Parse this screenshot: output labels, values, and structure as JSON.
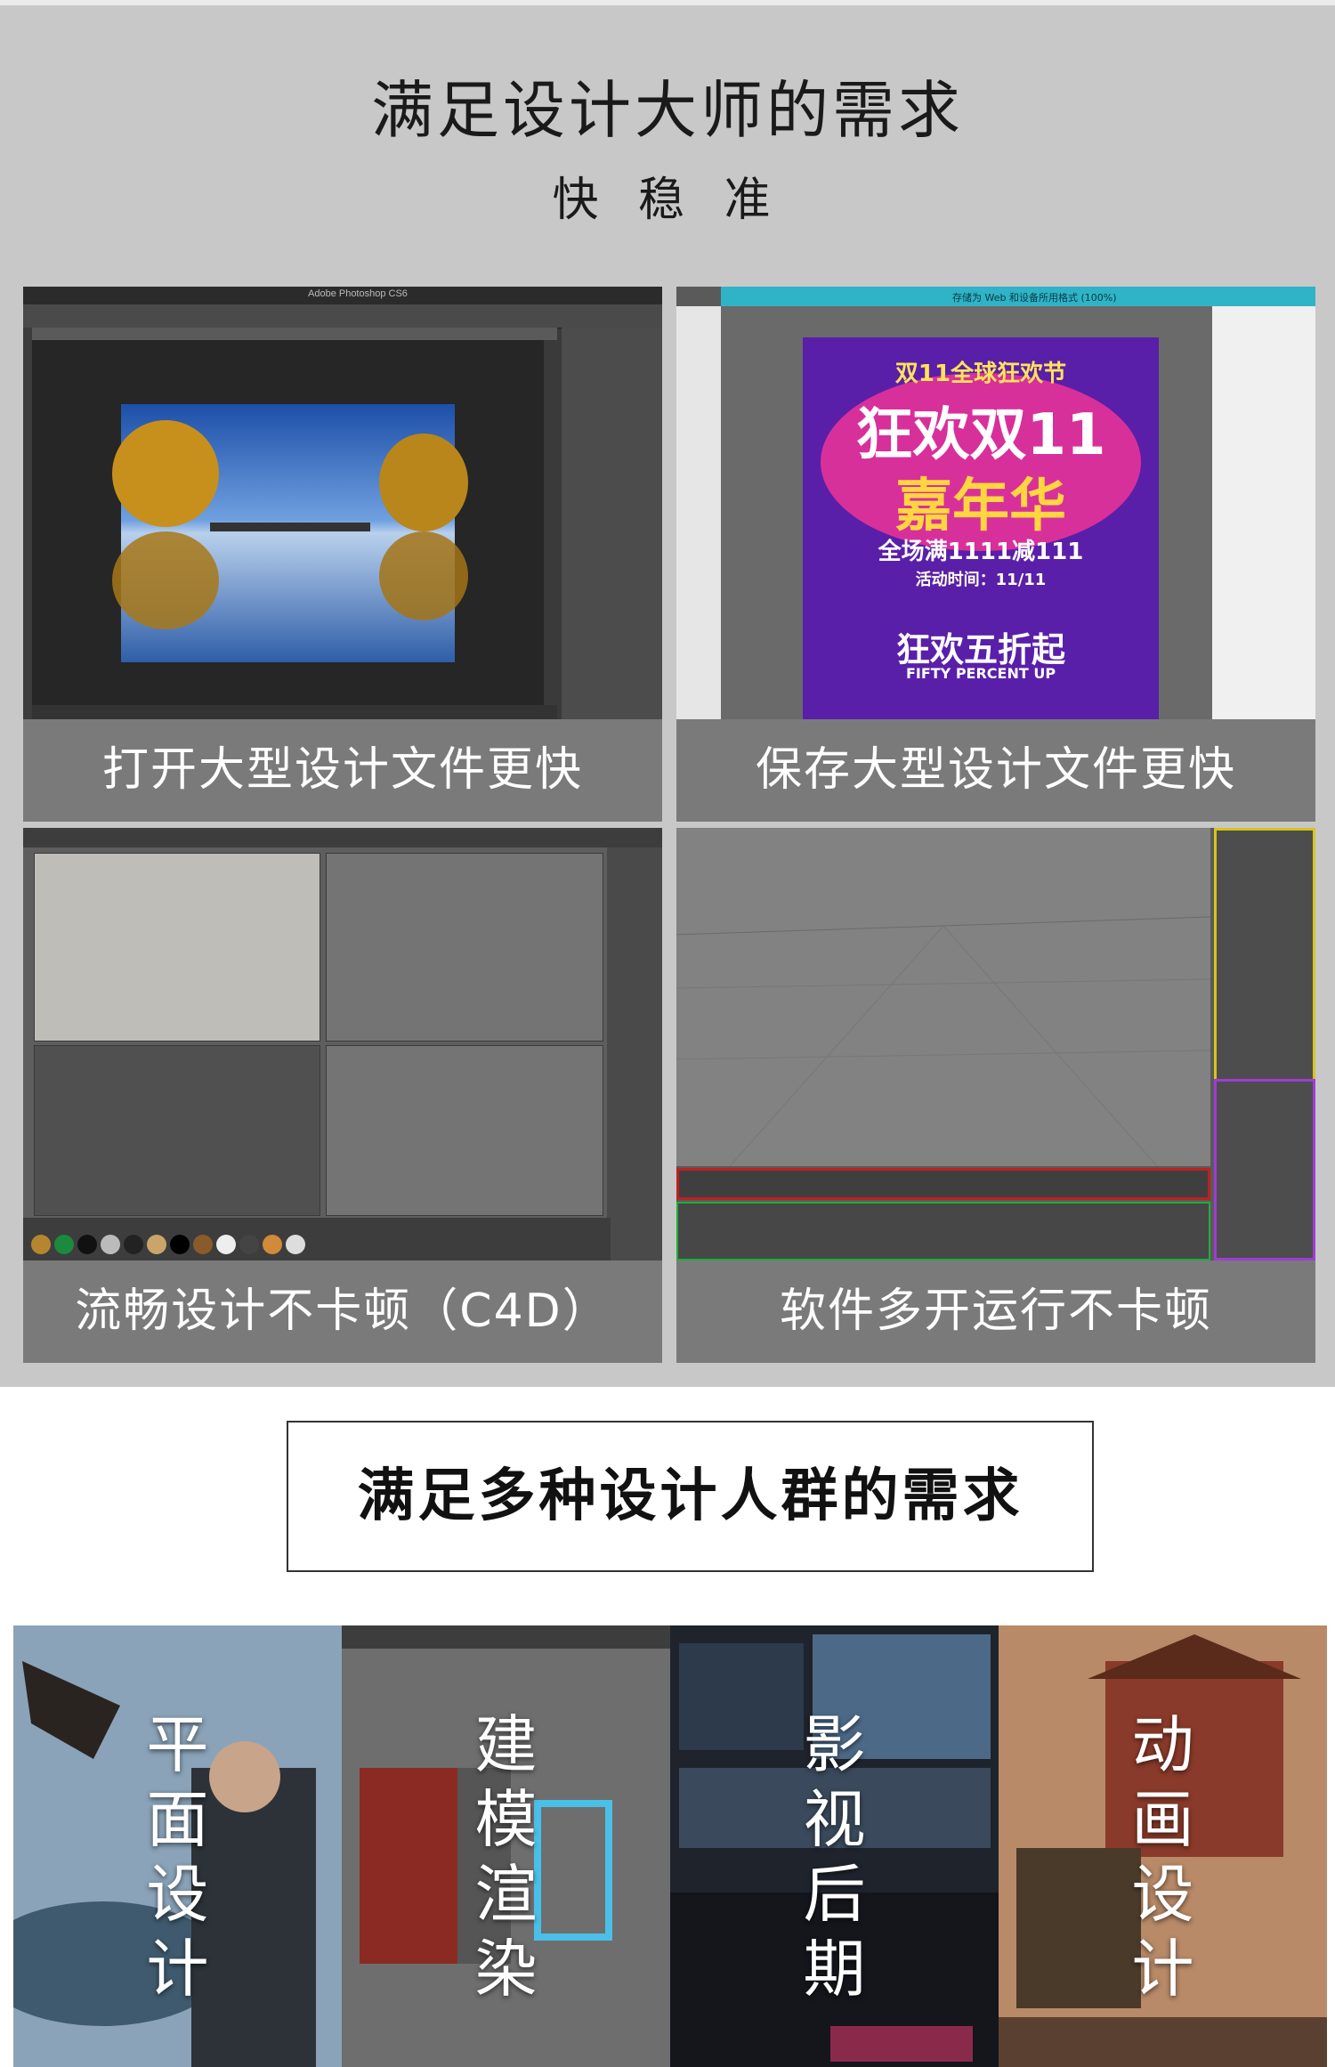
{
  "header": {
    "title": "满足设计大师的需求",
    "subtitle": "快 稳 准"
  },
  "cards": [
    {
      "caption": "打开大型设计文件更快",
      "window_title": "Adobe Photoshop CS6"
    },
    {
      "caption": "保存大型设计文件更快",
      "window_title": "存储为 Web 和设备所用格式 (100%)",
      "poster": {
        "line1": "双11全球狂欢节",
        "line2": "狂欢双11",
        "line3": "嘉年华",
        "line4": "全场满1111减111",
        "line5": "活动时间：11/11",
        "line6": "狂欢五折起",
        "line7": "FIFTY PERCENT UP"
      }
    },
    {
      "caption": "流畅设计不卡顿（C4D）"
    },
    {
      "caption": "软件多开运行不卡顿"
    }
  ],
  "section2": {
    "title": "满足多种设计人群的需求"
  },
  "categories": [
    {
      "label": "平\n面\n设\n计"
    },
    {
      "label": "建\n模\n渲\n染"
    },
    {
      "label": "影\n视\n后\n期"
    },
    {
      "label": "动\n画\n设\n计"
    }
  ],
  "colors": {
    "top_bg": "#c8c8c8",
    "caption_bg": "#7a7a7a",
    "red_frame": "#c02020",
    "yellow_frame": "#d8c41c",
    "green_frame": "#1fae3a",
    "purple_frame": "#a03bd6"
  }
}
